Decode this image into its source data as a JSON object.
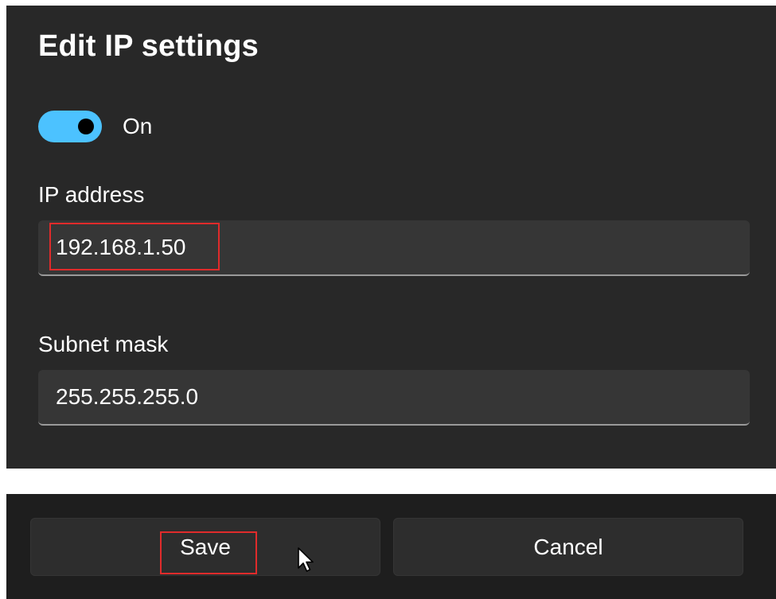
{
  "dialog": {
    "title": "Edit IP settings",
    "toggle": {
      "state_label": "On",
      "is_on": true,
      "track_color": "#4cc2ff"
    },
    "ip_address": {
      "label": "IP address",
      "value": "192.168.1.50"
    },
    "subnet_mask": {
      "label": "Subnet mask",
      "value": "255.255.255.0"
    }
  },
  "footer": {
    "save_label": "Save",
    "cancel_label": "Cancel"
  },
  "annotations": {
    "highlight_color": "#e02b2b"
  },
  "icons": {
    "cursor": "mouse-pointer-icon"
  }
}
